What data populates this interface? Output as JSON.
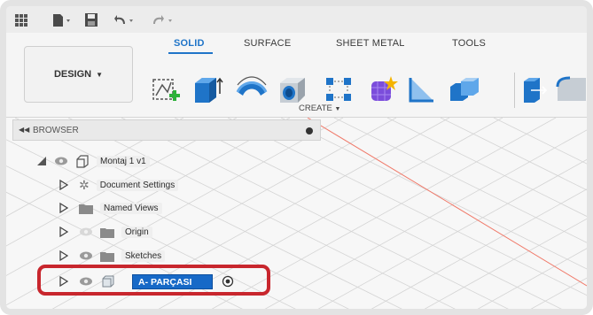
{
  "quick_access": {
    "icons": [
      "grid-icon",
      "file-icon",
      "save-icon",
      "undo-icon",
      "redo-icon"
    ]
  },
  "ribbon": {
    "tabs": [
      {
        "label": "SOLID",
        "active": true
      },
      {
        "label": "SURFACE",
        "active": false
      },
      {
        "label": "SHEET METAL",
        "active": false
      },
      {
        "label": "TOOLS",
        "active": false
      }
    ],
    "workspace_label": "DESIGN",
    "group_label": "CREATE",
    "tools": [
      "new-sketch-icon",
      "extrude-icon",
      "revolve-icon",
      "hole-icon",
      "pattern-icon",
      "form-icon",
      "rib-icon",
      "combine-icon",
      "press-pull-icon",
      "fillet-icon"
    ]
  },
  "browser": {
    "title": "BROWSER",
    "items": [
      {
        "label": "Montaj 1 v1"
      },
      {
        "label": "Document Settings"
      },
      {
        "label": "Named Views"
      },
      {
        "label": "Origin"
      },
      {
        "label": "Sketches"
      },
      {
        "label": "A- PARÇASI",
        "editing": true
      }
    ]
  },
  "colors": {
    "accent": "#1f74c8",
    "highlight": "#c8262d",
    "edit_bg": "#1769c7"
  }
}
